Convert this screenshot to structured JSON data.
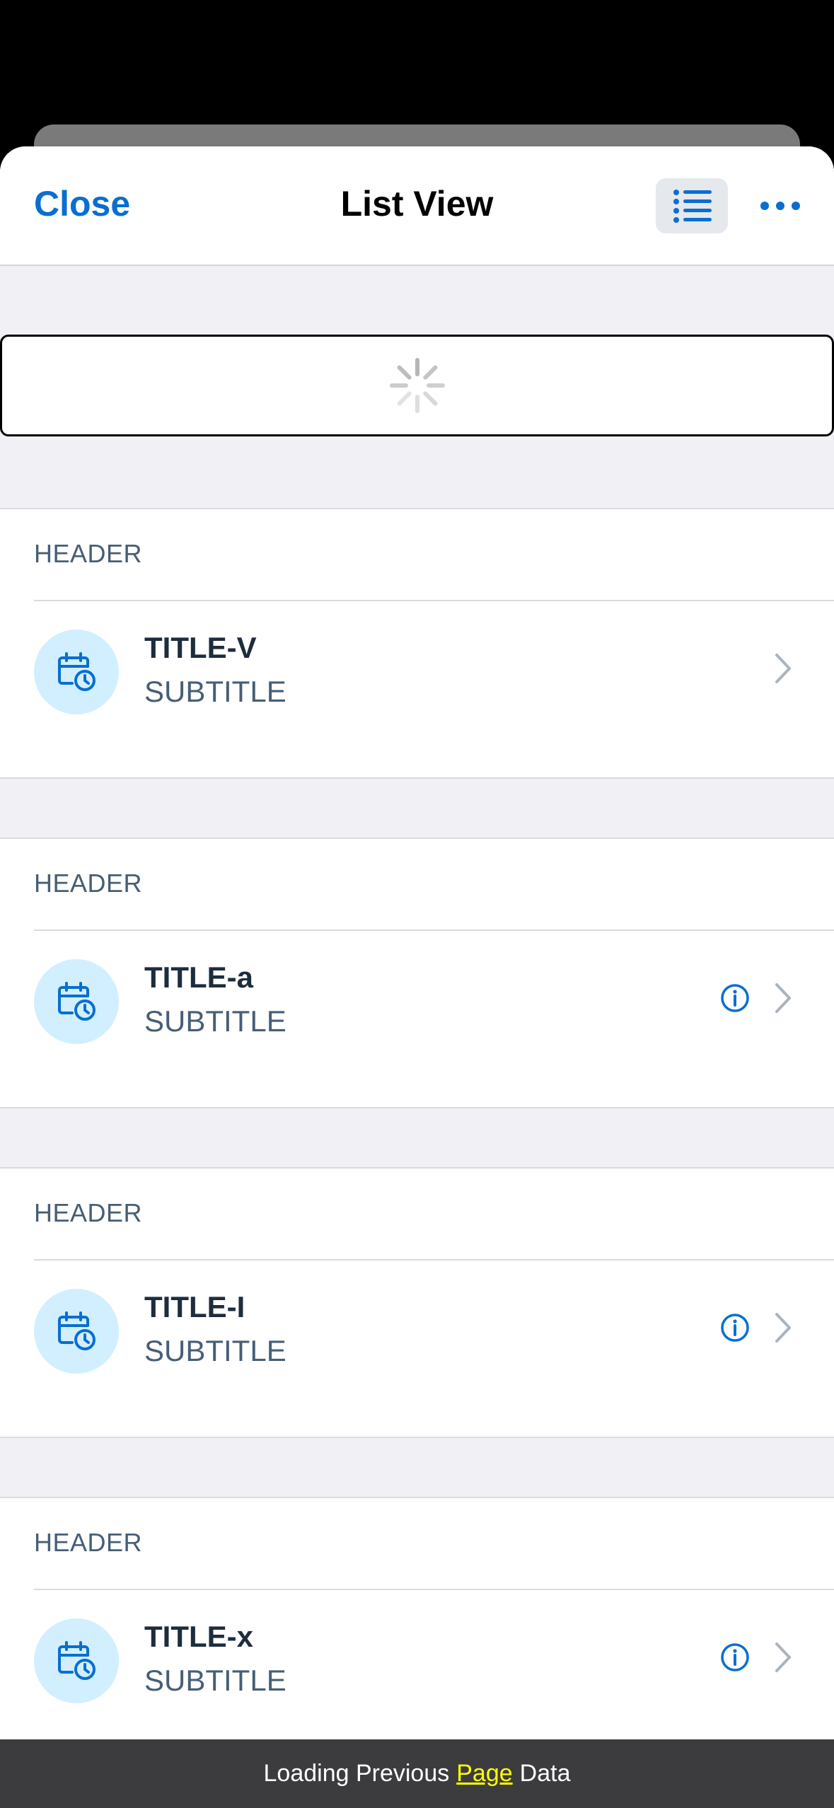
{
  "nav": {
    "close_label": "Close",
    "title": "List View",
    "list_icon": "list-icon",
    "more_icon": "more-horizontal-icon"
  },
  "loading": {
    "icon": "spinner-icon"
  },
  "sections": [
    {
      "header": "HEADER",
      "title": "TITLE-V",
      "subtitle": "SUBTITLE",
      "has_info": false
    },
    {
      "header": "HEADER",
      "title": "TITLE-a",
      "subtitle": "SUBTITLE",
      "has_info": true
    },
    {
      "header": "HEADER",
      "title": "TITLE-I",
      "subtitle": "SUBTITLE",
      "has_info": true
    },
    {
      "header": "HEADER",
      "title": "TITLE-x",
      "subtitle": "SUBTITLE",
      "has_info": true
    }
  ],
  "toast": {
    "prefix": "Loading Previous",
    "highlight": "Page",
    "suffix": "Data"
  },
  "colors": {
    "accent": "#0a6ed1",
    "avatar_bg": "#d1efff",
    "toast_highlight": "#ffff00"
  }
}
